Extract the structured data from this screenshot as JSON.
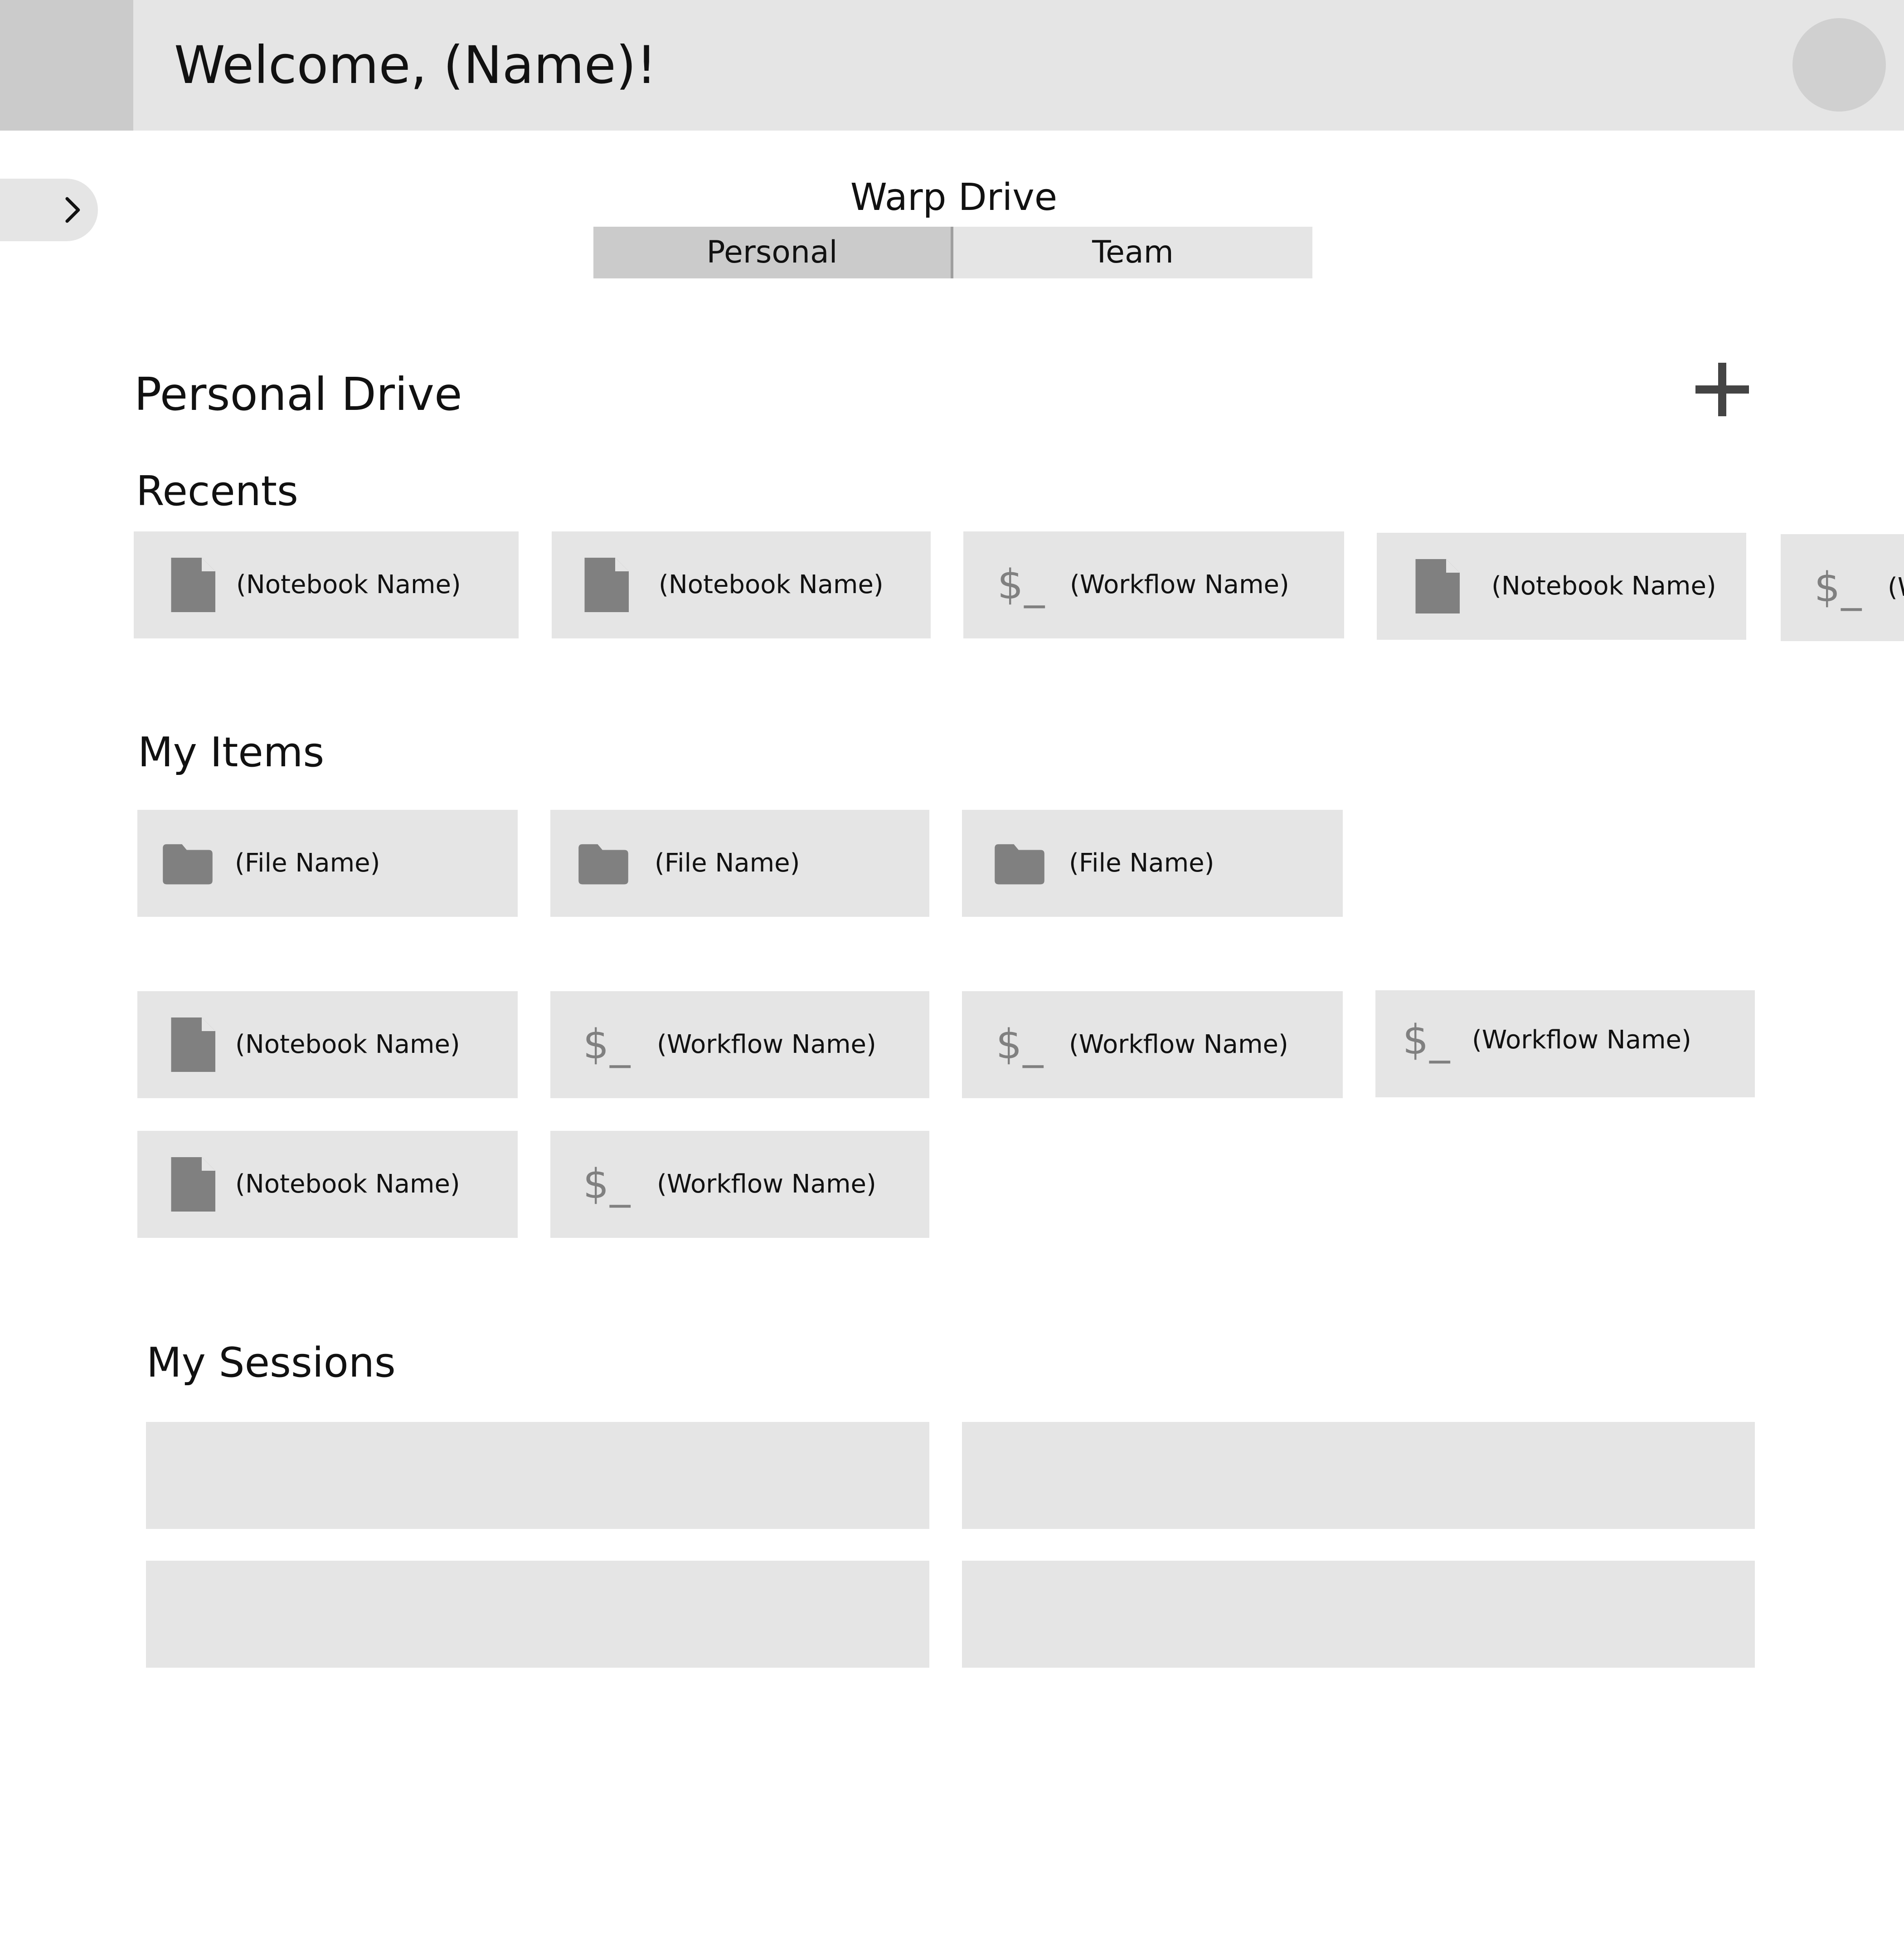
{
  "header": {
    "welcome_text": "Welcome, (Name)!"
  },
  "icons": {
    "sidebar_toggle": "chevron-right-icon",
    "add": "plus-icon",
    "notebook": "document-icon",
    "workflow": "terminal-dollar-icon",
    "file": "folder-icon"
  },
  "warp_drive": {
    "title": "Warp Drive",
    "tabs": [
      {
        "label": "Personal",
        "selected": true
      },
      {
        "label": "Team",
        "selected": false
      }
    ]
  },
  "personal_drive": {
    "title": "Personal Drive",
    "recents": {
      "title": "Recents",
      "items": [
        {
          "type": "notebook",
          "label": "(Notebook Name)"
        },
        {
          "type": "notebook",
          "label": "(Notebook Name)"
        },
        {
          "type": "workflow",
          "label": "(Workflow Name)",
          "icon_text": "$_"
        },
        {
          "type": "notebook",
          "label": "(Notebook Name)"
        },
        {
          "type": "workflow",
          "label": "(W",
          "icon_text": "$_"
        }
      ]
    },
    "my_items": {
      "title": "My Items",
      "files": [
        {
          "type": "file",
          "label": "(File Name)"
        },
        {
          "type": "file",
          "label": "(File Name)"
        },
        {
          "type": "file",
          "label": "(File Name)"
        }
      ],
      "items_row_1": [
        {
          "type": "notebook",
          "label": "(Notebook Name)"
        },
        {
          "type": "workflow",
          "label": "(Workflow Name)",
          "icon_text": "$_"
        },
        {
          "type": "workflow",
          "label": "(Workflow Name)",
          "icon_text": "$_"
        },
        {
          "type": "workflow",
          "label": "(Workflow Name)",
          "icon_text": "$_"
        }
      ],
      "items_row_2": [
        {
          "type": "notebook",
          "label": "(Notebook Name)"
        },
        {
          "type": "workflow",
          "label": "(Workflow Name)",
          "icon_text": "$_"
        }
      ]
    },
    "my_sessions": {
      "title": "My Sessions",
      "session_count": 4
    }
  },
  "colors": {
    "header_bg": "#e5e5e5",
    "logo_bg": "#cbcbcb",
    "card_bg": "#e5e5e5",
    "icon_gray": "#808080",
    "plus_gray": "#444444"
  }
}
